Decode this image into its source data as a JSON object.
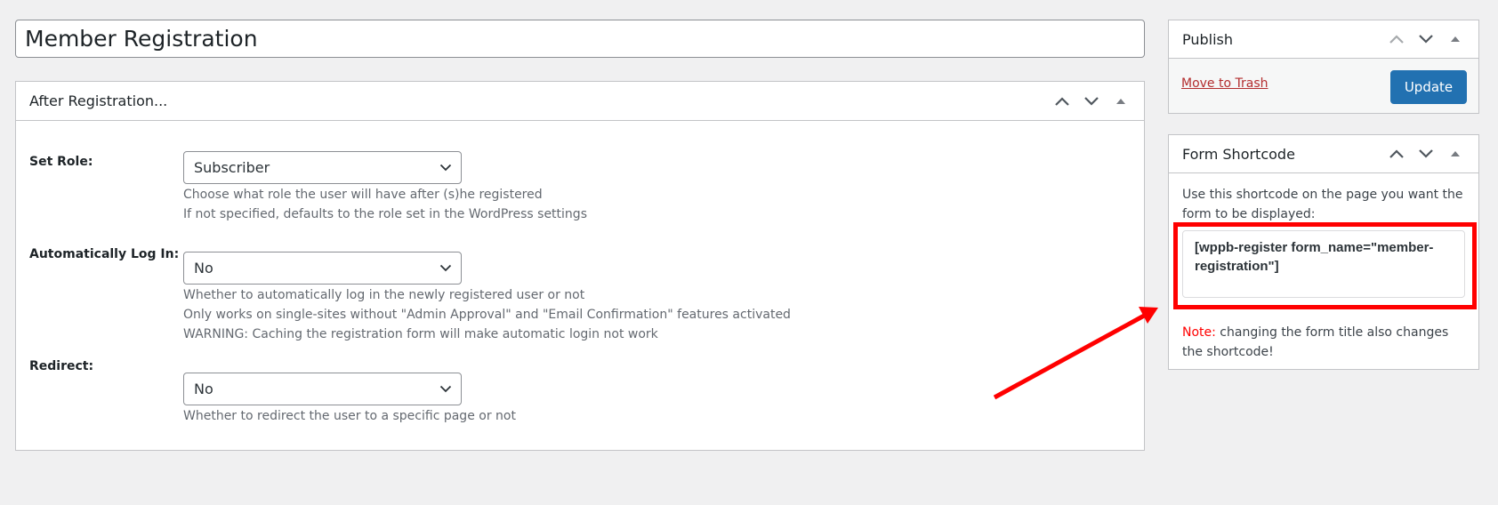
{
  "title_input": {
    "value": "Member Registration"
  },
  "after_registration": {
    "title": "After Registration...",
    "fields": [
      {
        "label": "Set Role:",
        "value": "Subscriber",
        "description": [
          "Choose what role the user will have after (s)he registered",
          "If not specified, defaults to the role set in the WordPress settings"
        ]
      },
      {
        "label": "Automatically Log In:",
        "value": "No",
        "description": [
          "Whether to automatically log in the newly registered user or not",
          "Only works on single-sites without \"Admin Approval\" and \"Email Confirmation\" features activated",
          "WARNING: Caching the registration form will make automatic login not work"
        ]
      },
      {
        "label": "Redirect:",
        "value": "No",
        "description": [
          "Whether to redirect the user to a specific page or not"
        ]
      }
    ]
  },
  "publish": {
    "title": "Publish",
    "trash_label": "Move to Trash",
    "update_label": "Update"
  },
  "form_shortcode": {
    "title": "Form Shortcode",
    "intro": "Use this shortcode on the page you want the form to be displayed:",
    "shortcode": "[wppb-register form_name=\"member-registration\"]",
    "note_label": "Note:",
    "note_text": " changing the form title also changes the shortcode!"
  },
  "colors": {
    "accent": "#2271b1",
    "trash": "#b32d2e",
    "annotation": "#ff0000",
    "background": "#f0f0f1"
  },
  "icons": {
    "move_up": "chevron-up-icon",
    "move_down": "chevron-down-icon",
    "toggle": "triangle-up-icon",
    "select_arrow": "chevron-down-icon"
  }
}
